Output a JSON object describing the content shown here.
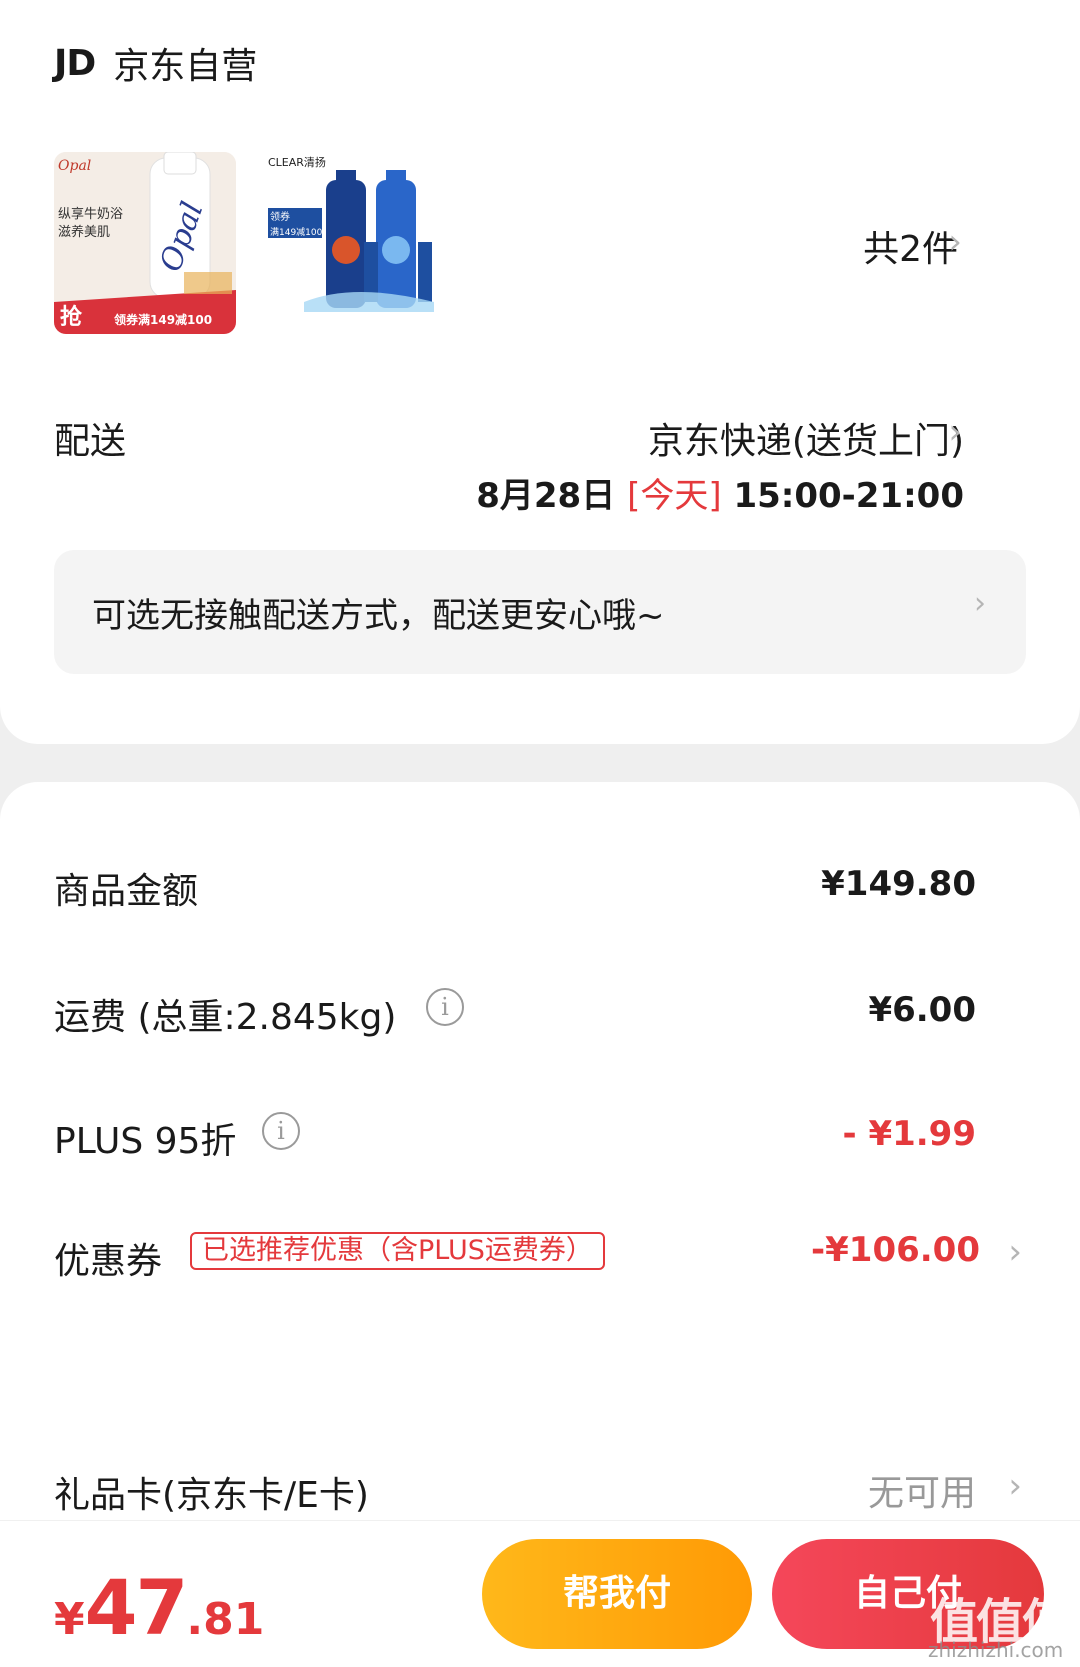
{
  "store": {
    "logo_text": "JD",
    "name": "京东自营"
  },
  "products": {
    "count_label": "共2件",
    "items": [
      {
        "brand": "Opal",
        "tagline": "纵享牛奶浴 滋养美肌",
        "badge": "抢",
        "promo": "领券满149减100"
      },
      {
        "brand": "CLEAR清扬",
        "promo": "领券 满149减100"
      }
    ]
  },
  "delivery": {
    "label": "配送",
    "method": "京东快递(送货上门)",
    "date": "8月28日",
    "today_tag": "[今天]",
    "time_range": "15:00-21:00",
    "notice": "可选无接触配送方式，配送更安心哦~"
  },
  "summary": {
    "goods_label": "商品金额",
    "goods_value": "¥149.80",
    "shipping_label": "运费 (总重:2.845kg)",
    "shipping_value": "¥6.00",
    "plus_label": "PLUS 95折",
    "plus_value": "- ¥1.99",
    "coupon_label": "优惠券",
    "coupon_tag": "已选推荐优惠（含PLUS运费券）",
    "coupon_value": "-¥106.00",
    "giftcard_label": "礼品卡(京东卡/E卡)",
    "giftcard_value": "无可用"
  },
  "footer": {
    "total_symbol": "¥",
    "total_int": "47",
    "total_dec": ".81",
    "help_pay_label": "帮我付",
    "self_pay_label": "自己付"
  },
  "watermark": {
    "text": "值值值",
    "url": "zhizhizhi.com"
  },
  "colors": {
    "accent_red": "#e4393c",
    "help_orange": "#ffa50a",
    "background": "#efefef"
  }
}
